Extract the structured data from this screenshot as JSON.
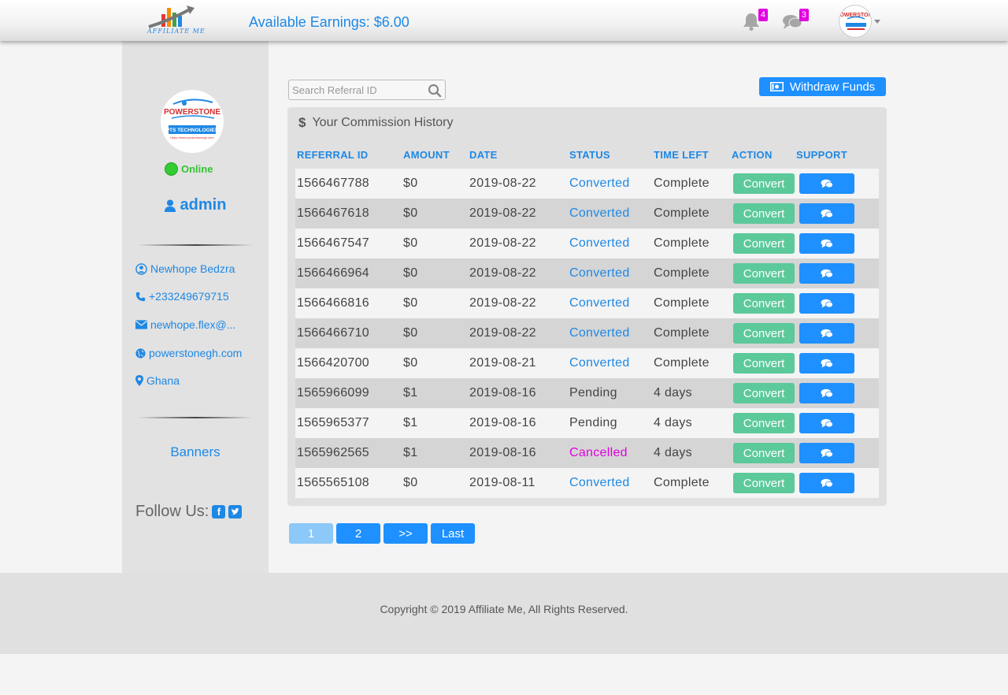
{
  "header": {
    "logo_text": "AFFILIATE ME",
    "earnings": "Available Earnings: $6.00",
    "notifications_count": "4",
    "messages_count": "3"
  },
  "sidebar": {
    "status": "Online",
    "username": "admin",
    "name": "Newhope Bedzra",
    "phone": "+233249679715",
    "email": "newhope.flex@...",
    "website": "powerstonegh.com",
    "country": "Ghana",
    "banners": "Banners",
    "follow": "Follow Us:"
  },
  "logo": {
    "brand": "POWERSTONE",
    "sub": "PTS TECHNOLOGIES",
    "url": "https://www.powerstonegh.com"
  },
  "main": {
    "search_placeholder": "Search Referral ID",
    "withdraw_label": "Withdraw Funds",
    "panel_title": "Your Commission History",
    "columns": [
      "REFERRAL ID",
      "AMOUNT",
      "DATE",
      "STATUS",
      "TIME LEFT",
      "ACTION",
      "SUPPORT"
    ],
    "convert_label": "Convert",
    "rows": [
      {
        "id": "1566467788",
        "amount": "$0",
        "date": "2019-08-22",
        "status": "Converted",
        "time_left": "Complete"
      },
      {
        "id": "1566467618",
        "amount": "$0",
        "date": "2019-08-22",
        "status": "Converted",
        "time_left": "Complete"
      },
      {
        "id": "1566467547",
        "amount": "$0",
        "date": "2019-08-22",
        "status": "Converted",
        "time_left": "Complete"
      },
      {
        "id": "1566466964",
        "amount": "$0",
        "date": "2019-08-22",
        "status": "Converted",
        "time_left": "Complete"
      },
      {
        "id": "1566466816",
        "amount": "$0",
        "date": "2019-08-22",
        "status": "Converted",
        "time_left": "Complete"
      },
      {
        "id": "1566466710",
        "amount": "$0",
        "date": "2019-08-22",
        "status": "Converted",
        "time_left": "Complete"
      },
      {
        "id": "1566420700",
        "amount": "$0",
        "date": "2019-08-21",
        "status": "Converted",
        "time_left": "Complete"
      },
      {
        "id": "1565966099",
        "amount": "$1",
        "date": "2019-08-16",
        "status": "Pending",
        "time_left": "4 days"
      },
      {
        "id": "1565965377",
        "amount": "$1",
        "date": "2019-08-16",
        "status": "Pending",
        "time_left": "4 days"
      },
      {
        "id": "1565962565",
        "amount": "$1",
        "date": "2019-08-16",
        "status": "Cancelled",
        "time_left": "4 days"
      },
      {
        "id": "1565565108",
        "amount": "$0",
        "date": "2019-08-11",
        "status": "Converted",
        "time_left": "Complete"
      }
    ],
    "status_colors": {
      "Converted": "#1e88e5",
      "Pending": "#444444",
      "Cancelled": "#e100e1"
    },
    "pagination": [
      "1",
      "2",
      ">>",
      "Last"
    ],
    "current_page": "1"
  },
  "footer": {
    "copyright": "Copyright © 2019 Affiliate Me, All Rights Reserved."
  }
}
